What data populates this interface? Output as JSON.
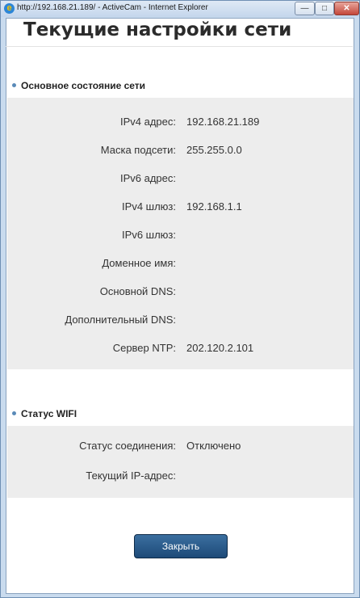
{
  "window": {
    "title": "http://192.168.21.189/ - ActiveCam - Internet Explorer",
    "min_symbol": "—",
    "max_symbol": "□",
    "close_symbol": "✕"
  },
  "page": {
    "title": "Текущие настройки сети"
  },
  "network": {
    "heading": "Основное состояние сети",
    "rows": [
      {
        "label": "IPv4 адрес:",
        "value": "192.168.21.189"
      },
      {
        "label": "Маска подсети:",
        "value": "255.255.0.0"
      },
      {
        "label": "IPv6 адрес:",
        "value": ""
      },
      {
        "label": "IPv4 шлюз:",
        "value": "192.168.1.1"
      },
      {
        "label": "IPv6 шлюз:",
        "value": ""
      },
      {
        "label": "Доменное имя:",
        "value": ""
      },
      {
        "label": "Основной DNS:",
        "value": ""
      },
      {
        "label": "Дополнительный DNS:",
        "value": ""
      },
      {
        "label": "Сервер NTP:",
        "value": "202.120.2.101"
      }
    ]
  },
  "wifi": {
    "heading": "Статус WIFI",
    "rows": [
      {
        "label": "Статус соединения:",
        "value": "Отключено"
      },
      {
        "label": "Текущий IP-адрес:",
        "value": ""
      }
    ]
  },
  "close_button": {
    "label": "Закрыть"
  },
  "colors": {
    "panel_bg": "#ededed",
    "button_bg": "#1d4a78",
    "bullet": "#5a8ab8"
  },
  "icons": {
    "browser": "internet-explorer-icon"
  }
}
